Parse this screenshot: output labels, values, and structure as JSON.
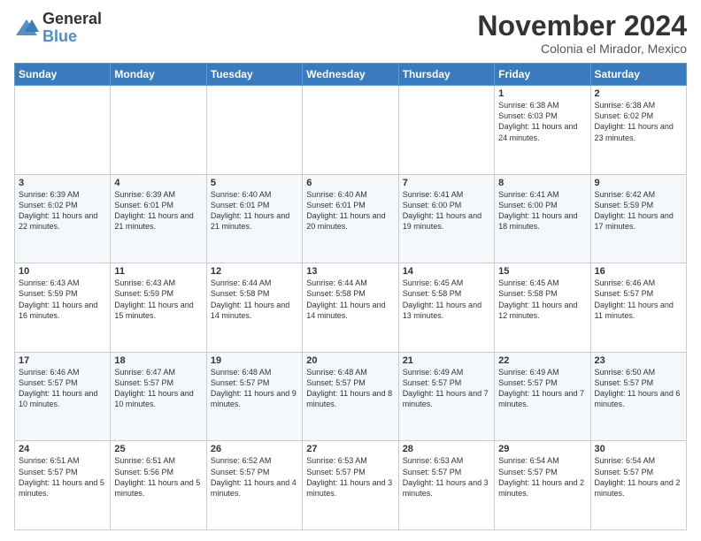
{
  "logo": {
    "general": "General",
    "blue": "Blue"
  },
  "header": {
    "month": "November 2024",
    "location": "Colonia el Mirador, Mexico"
  },
  "days_of_week": [
    "Sunday",
    "Monday",
    "Tuesday",
    "Wednesday",
    "Thursday",
    "Friday",
    "Saturday"
  ],
  "weeks": [
    [
      {
        "day": "",
        "info": ""
      },
      {
        "day": "",
        "info": ""
      },
      {
        "day": "",
        "info": ""
      },
      {
        "day": "",
        "info": ""
      },
      {
        "day": "",
        "info": ""
      },
      {
        "day": "1",
        "info": "Sunrise: 6:38 AM\nSunset: 6:03 PM\nDaylight: 11 hours and 24 minutes."
      },
      {
        "day": "2",
        "info": "Sunrise: 6:38 AM\nSunset: 6:02 PM\nDaylight: 11 hours and 23 minutes."
      }
    ],
    [
      {
        "day": "3",
        "info": "Sunrise: 6:39 AM\nSunset: 6:02 PM\nDaylight: 11 hours and 22 minutes."
      },
      {
        "day": "4",
        "info": "Sunrise: 6:39 AM\nSunset: 6:01 PM\nDaylight: 11 hours and 21 minutes."
      },
      {
        "day": "5",
        "info": "Sunrise: 6:40 AM\nSunset: 6:01 PM\nDaylight: 11 hours and 21 minutes."
      },
      {
        "day": "6",
        "info": "Sunrise: 6:40 AM\nSunset: 6:01 PM\nDaylight: 11 hours and 20 minutes."
      },
      {
        "day": "7",
        "info": "Sunrise: 6:41 AM\nSunset: 6:00 PM\nDaylight: 11 hours and 19 minutes."
      },
      {
        "day": "8",
        "info": "Sunrise: 6:41 AM\nSunset: 6:00 PM\nDaylight: 11 hours and 18 minutes."
      },
      {
        "day": "9",
        "info": "Sunrise: 6:42 AM\nSunset: 5:59 PM\nDaylight: 11 hours and 17 minutes."
      }
    ],
    [
      {
        "day": "10",
        "info": "Sunrise: 6:43 AM\nSunset: 5:59 PM\nDaylight: 11 hours and 16 minutes."
      },
      {
        "day": "11",
        "info": "Sunrise: 6:43 AM\nSunset: 5:59 PM\nDaylight: 11 hours and 15 minutes."
      },
      {
        "day": "12",
        "info": "Sunrise: 6:44 AM\nSunset: 5:58 PM\nDaylight: 11 hours and 14 minutes."
      },
      {
        "day": "13",
        "info": "Sunrise: 6:44 AM\nSunset: 5:58 PM\nDaylight: 11 hours and 14 minutes."
      },
      {
        "day": "14",
        "info": "Sunrise: 6:45 AM\nSunset: 5:58 PM\nDaylight: 11 hours and 13 minutes."
      },
      {
        "day": "15",
        "info": "Sunrise: 6:45 AM\nSunset: 5:58 PM\nDaylight: 11 hours and 12 minutes."
      },
      {
        "day": "16",
        "info": "Sunrise: 6:46 AM\nSunset: 5:57 PM\nDaylight: 11 hours and 11 minutes."
      }
    ],
    [
      {
        "day": "17",
        "info": "Sunrise: 6:46 AM\nSunset: 5:57 PM\nDaylight: 11 hours and 10 minutes."
      },
      {
        "day": "18",
        "info": "Sunrise: 6:47 AM\nSunset: 5:57 PM\nDaylight: 11 hours and 10 minutes."
      },
      {
        "day": "19",
        "info": "Sunrise: 6:48 AM\nSunset: 5:57 PM\nDaylight: 11 hours and 9 minutes."
      },
      {
        "day": "20",
        "info": "Sunrise: 6:48 AM\nSunset: 5:57 PM\nDaylight: 11 hours and 8 minutes."
      },
      {
        "day": "21",
        "info": "Sunrise: 6:49 AM\nSunset: 5:57 PM\nDaylight: 11 hours and 7 minutes."
      },
      {
        "day": "22",
        "info": "Sunrise: 6:49 AM\nSunset: 5:57 PM\nDaylight: 11 hours and 7 minutes."
      },
      {
        "day": "23",
        "info": "Sunrise: 6:50 AM\nSunset: 5:57 PM\nDaylight: 11 hours and 6 minutes."
      }
    ],
    [
      {
        "day": "24",
        "info": "Sunrise: 6:51 AM\nSunset: 5:57 PM\nDaylight: 11 hours and 5 minutes."
      },
      {
        "day": "25",
        "info": "Sunrise: 6:51 AM\nSunset: 5:56 PM\nDaylight: 11 hours and 5 minutes."
      },
      {
        "day": "26",
        "info": "Sunrise: 6:52 AM\nSunset: 5:57 PM\nDaylight: 11 hours and 4 minutes."
      },
      {
        "day": "27",
        "info": "Sunrise: 6:53 AM\nSunset: 5:57 PM\nDaylight: 11 hours and 3 minutes."
      },
      {
        "day": "28",
        "info": "Sunrise: 6:53 AM\nSunset: 5:57 PM\nDaylight: 11 hours and 3 minutes."
      },
      {
        "day": "29",
        "info": "Sunrise: 6:54 AM\nSunset: 5:57 PM\nDaylight: 11 hours and 2 minutes."
      },
      {
        "day": "30",
        "info": "Sunrise: 6:54 AM\nSunset: 5:57 PM\nDaylight: 11 hours and 2 minutes."
      }
    ]
  ]
}
